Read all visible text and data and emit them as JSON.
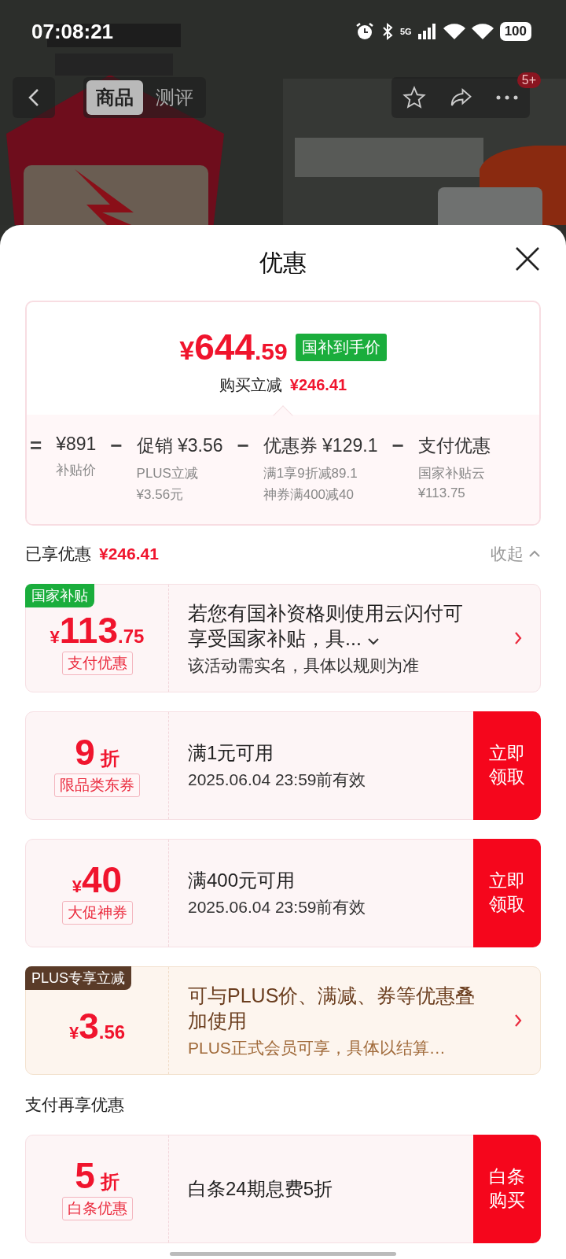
{
  "status_bar": {
    "time": "07:08:21",
    "network": "5G",
    "battery": "100"
  },
  "nav": {
    "tabs": [
      {
        "label": "商品",
        "selected": true
      },
      {
        "label": "测评",
        "selected": false
      }
    ],
    "badge": "5+"
  },
  "sheet": {
    "title": "优惠",
    "summary": {
      "price": {
        "currency": "¥",
        "integer": "644",
        "decimal": ".59"
      },
      "tag": "国补到手价",
      "saving_label": "购买立减",
      "saving": "¥246.41",
      "breakdown": [
        {
          "op": "=",
          "amount": "¥891",
          "notes": [
            "补贴价"
          ]
        },
        {
          "op": "−",
          "label": "促销",
          "amount": "¥3.56",
          "notes": [
            "PLUS立减",
            "¥3.56元"
          ]
        },
        {
          "op": "−",
          "label": "优惠券",
          "amount": "¥129.1",
          "notes": [
            "满1享9折减89.1",
            "神券满400减40"
          ]
        },
        {
          "op": "−",
          "label": "支付优惠",
          "notes": [
            "国家补贴云",
            "¥113.75"
          ]
        }
      ]
    },
    "applied": {
      "label": "已享优惠",
      "amount": "¥246.41",
      "toggle": "收起",
      "expanded": true
    },
    "offers": [
      {
        "kind": "subsidy",
        "tag": {
          "text": "国家补贴",
          "color": "#1aad3c"
        },
        "value": {
          "currency": "¥",
          "integer": "113",
          "decimal": ".75"
        },
        "label": "支付优惠",
        "title": "若您有国补资格则使用云闪付可享受国家补贴，具...",
        "description": "该活动需实名，具体以规则为准"
      },
      {
        "kind": "coupon",
        "value": {
          "integer": "9",
          "unit": "折"
        },
        "label": "限品类东券",
        "title": "满1元可用",
        "description": "2025.06.04 23:59前有效",
        "action": "立即领取"
      },
      {
        "kind": "coupon",
        "value": {
          "currency": "¥",
          "integer": "40"
        },
        "label": "大促神券",
        "title": "满400元可用",
        "description": "2025.06.04 23:59前有效",
        "action": "立即领取"
      },
      {
        "kind": "plus",
        "tag": {
          "text": "PLUS专享立减",
          "color": "#5a3b28"
        },
        "value": {
          "currency": "¥",
          "integer": "3",
          "decimal": ".56"
        },
        "title": "可与PLUS价、满减、券等优惠叠加使用",
        "description": "PLUS正式会员可享，具体以结算…"
      }
    ],
    "pay_section": {
      "title": "支付再享优惠",
      "offers": [
        {
          "kind": "coupon",
          "value": {
            "integer": "5",
            "unit": "折"
          },
          "label": "白条优惠",
          "title": "白条24期息费5折",
          "action": "白条购买"
        }
      ]
    }
  }
}
